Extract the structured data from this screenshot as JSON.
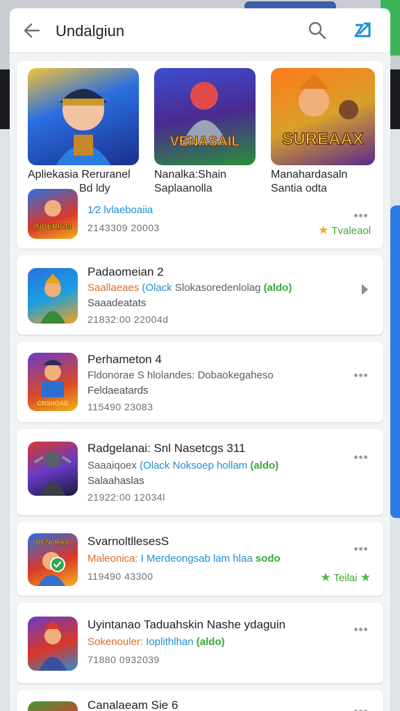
{
  "header": {
    "title": "Undalgiun",
    "back_icon": "back-arrow-icon",
    "search_icon": "search-icon",
    "action_icon": "expand-icon",
    "accent": "#1a8fd6"
  },
  "featured": {
    "apps": [
      {
        "name": "Apliekasia Reruranel",
        "sub": "Bd ldy"
      },
      {
        "name": "Nanalka:Shain",
        "sub": "Saplaanolla",
        "art_text": "VENASAIL"
      },
      {
        "name": "Manahardasaln",
        "sub": "Santia odta",
        "art_text": "SUREAAX"
      }
    ],
    "row": {
      "art_text": "INDERIAM",
      "title": "1⁄2 lvlaeboaiia",
      "date": "2143309 20003",
      "rating_label": "Tvaleaol"
    }
  },
  "list": [
    {
      "title": "Padaomeian 2",
      "desc": [
        "Saallaeaes",
        "(Olack",
        "Slokasoredenlolag",
        "(aldo)"
      ],
      "cat": "Saaadeatats",
      "date": "21832:00 22004d",
      "trailing": "chevron-right-icon"
    },
    {
      "title": "Perhameton 4",
      "desc": [
        "",
        "",
        "Fldonorae S hlolandes: Dobaokegaheso",
        ""
      ],
      "cat": "Feldaeatards",
      "date": "115490 23083",
      "art_text": "CRSHOAE",
      "trailing": "more-icon"
    },
    {
      "title": "Radgelanai: Snl Nasetcgs 311",
      "desc": [
        "Saaaiqoex",
        "(Olack",
        "Noksoep hollam",
        "(aldo)"
      ],
      "cat": "Salaahaslas",
      "date": "21922:00 12034l",
      "trailing": "more-icon"
    },
    {
      "title": "SvarnoltllesesS",
      "desc": [
        "Maleonica:",
        "I Merdeongsab lam",
        "hlaa",
        "sodo"
      ],
      "cat": "",
      "date": "119490 43300",
      "art_text": "BENLRAA",
      "rating_label": "Teilai",
      "trailing": "more-icon"
    },
    {
      "title": "Uyintanao Taduahskin Nashe ydaguin",
      "desc": [
        "Sokenouler:",
        "",
        "Ioplithlhan",
        "(aldo)"
      ],
      "cat": "",
      "date": "71880 0932039",
      "trailing": "more-icon"
    },
    {
      "title": "Canalaeam Sie 6",
      "desc": [
        "",
        "",
        "",
        ""
      ],
      "cat": "",
      "date": "",
      "trailing": "more-icon"
    }
  ]
}
